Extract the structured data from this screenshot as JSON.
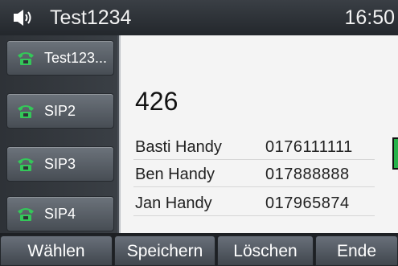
{
  "header": {
    "account": "Test1234",
    "time": "16:50",
    "speaker_icon": "speaker-icon"
  },
  "line_keys": [
    {
      "label": "Test123...",
      "icon": "handset-icon"
    },
    {
      "label": "SIP2",
      "icon": "handset-icon"
    },
    {
      "label": "SIP3",
      "icon": "handset-icon"
    },
    {
      "label": "SIP4",
      "icon": "handset-icon"
    }
  ],
  "dial": {
    "number": "426"
  },
  "results": [
    {
      "name": "Basti Handy",
      "number": "0176111111"
    },
    {
      "name": "Ben Handy",
      "number": "017888888"
    },
    {
      "name": "Jan Handy",
      "number": "017965874"
    }
  ],
  "softkeys": [
    "Wählen",
    "Speichern",
    "Löschen",
    "Ende"
  ],
  "colors": {
    "accent_green": "#27b24a",
    "header_bg": "#2a2e33",
    "content_bg": "#f4f4f4"
  }
}
